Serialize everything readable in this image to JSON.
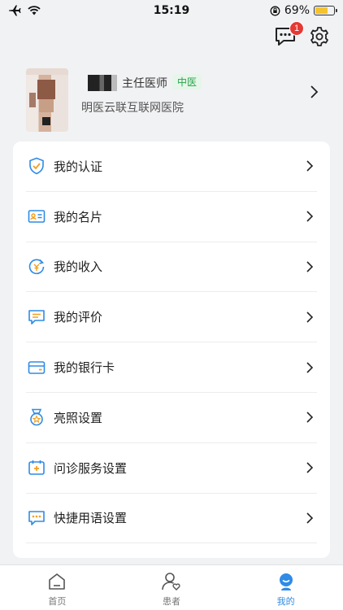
{
  "status_bar": {
    "time": "15:19",
    "battery_percent": "69%",
    "battery_level": 0.69
  },
  "header": {
    "message_badge_count": "1"
  },
  "profile": {
    "title": "主任医师",
    "tag": "中医",
    "hospital": "明医云联互联网医院"
  },
  "menu": {
    "items": [
      {
        "label": "我的认证",
        "icon": "shield-check-icon"
      },
      {
        "label": "我的名片",
        "icon": "id-card-icon"
      },
      {
        "label": "我的收入",
        "icon": "income-icon"
      },
      {
        "label": "我的评价",
        "icon": "comment-icon"
      },
      {
        "label": "我的银行卡",
        "icon": "bank-card-icon"
      },
      {
        "label": "亮照设置",
        "icon": "medal-icon"
      },
      {
        "label": "问诊服务设置",
        "icon": "calendar-plus-icon"
      },
      {
        "label": "快捷用语设置",
        "icon": "chat-dots-icon"
      }
    ]
  },
  "tabbar": {
    "tabs": [
      {
        "label": "首页",
        "active": false
      },
      {
        "label": "患者",
        "active": false
      },
      {
        "label": "我的",
        "active": true
      }
    ]
  },
  "colors": {
    "accent": "#2f8be6",
    "icon_orange": "#f0a020",
    "tag_green": "#2aa34a",
    "badge_red": "#e53935"
  }
}
